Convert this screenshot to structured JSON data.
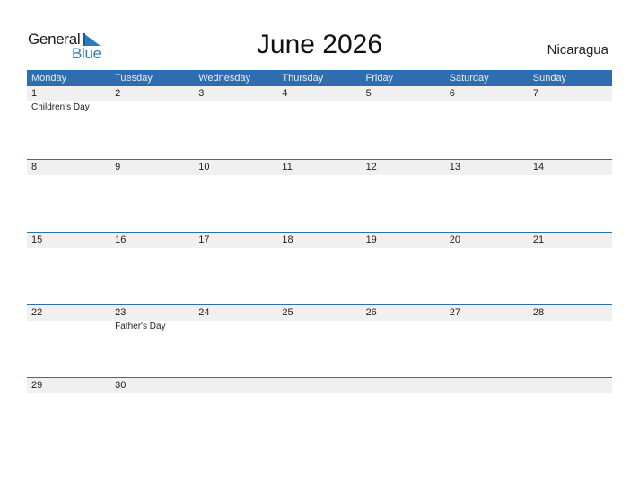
{
  "logo": {
    "word1": "General",
    "word2": "Blue",
    "icon": "blue-triangle-flag-icon",
    "accent": "#2a78c4"
  },
  "title": "June 2026",
  "country": "Nicaragua",
  "colors": {
    "header_bg": "#2e6eb0",
    "date_strip": "#f0f0f0"
  },
  "weekdays": [
    "Monday",
    "Tuesday",
    "Wednesday",
    "Thursday",
    "Friday",
    "Saturday",
    "Sunday"
  ],
  "weeks": [
    [
      {
        "day": "1",
        "event": "Children's Day"
      },
      {
        "day": "2",
        "event": ""
      },
      {
        "day": "3",
        "event": ""
      },
      {
        "day": "4",
        "event": ""
      },
      {
        "day": "5",
        "event": ""
      },
      {
        "day": "6",
        "event": ""
      },
      {
        "day": "7",
        "event": ""
      }
    ],
    [
      {
        "day": "8",
        "event": ""
      },
      {
        "day": "9",
        "event": ""
      },
      {
        "day": "10",
        "event": ""
      },
      {
        "day": "11",
        "event": ""
      },
      {
        "day": "12",
        "event": ""
      },
      {
        "day": "13",
        "event": ""
      },
      {
        "day": "14",
        "event": ""
      }
    ],
    [
      {
        "day": "15",
        "event": ""
      },
      {
        "day": "16",
        "event": ""
      },
      {
        "day": "17",
        "event": ""
      },
      {
        "day": "18",
        "event": ""
      },
      {
        "day": "19",
        "event": ""
      },
      {
        "day": "20",
        "event": ""
      },
      {
        "day": "21",
        "event": ""
      }
    ],
    [
      {
        "day": "22",
        "event": ""
      },
      {
        "day": "23",
        "event": "Father's Day"
      },
      {
        "day": "24",
        "event": ""
      },
      {
        "day": "25",
        "event": ""
      },
      {
        "day": "26",
        "event": ""
      },
      {
        "day": "27",
        "event": ""
      },
      {
        "day": "28",
        "event": ""
      }
    ],
    [
      {
        "day": "29",
        "event": ""
      },
      {
        "day": "30",
        "event": ""
      },
      {
        "day": "",
        "event": ""
      },
      {
        "day": "",
        "event": ""
      },
      {
        "day": "",
        "event": ""
      },
      {
        "day": "",
        "event": ""
      },
      {
        "day": "",
        "event": ""
      }
    ]
  ]
}
